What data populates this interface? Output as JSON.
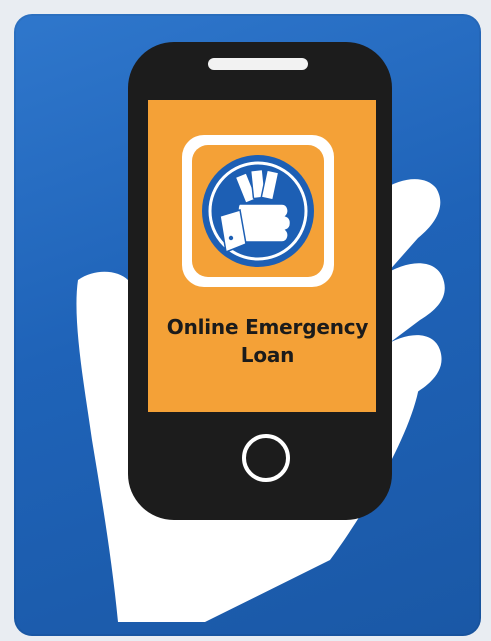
{
  "screen": {
    "label_line1": "Online Emergency",
    "label_line2": "Loan"
  },
  "icons": {
    "hand": "hand-icon",
    "phone": "smartphone-icon",
    "app": "loan-app-icon",
    "cash": "cash-in-hand-icon",
    "home_button": "home-button-icon"
  },
  "colors": {
    "panel_blue": "#1f63b8",
    "phone_body": "#1c1c1c",
    "screen_orange": "#f4a137",
    "app_blue": "#1d5fb4",
    "hand_white": "#ffffff"
  }
}
